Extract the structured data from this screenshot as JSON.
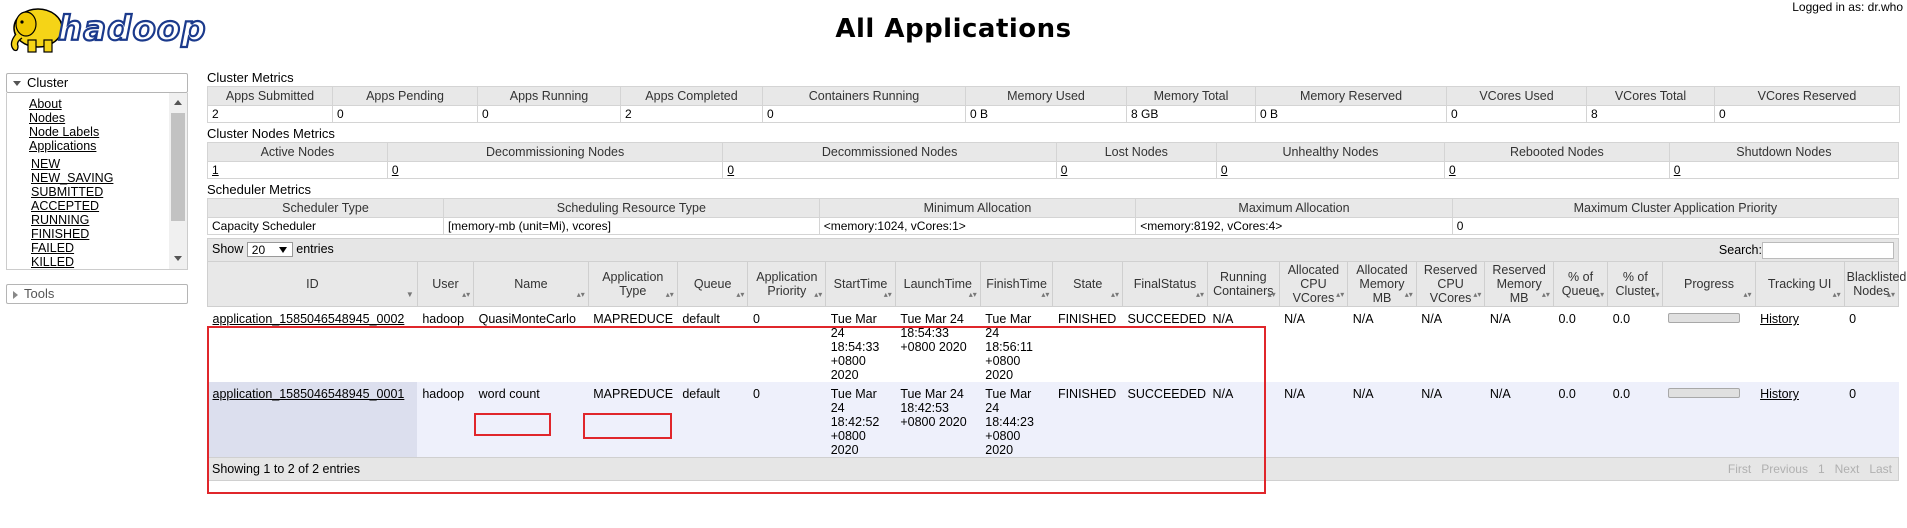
{
  "header": {
    "logo_text": "hadoop",
    "title": "All Applications",
    "login": "Logged in as: dr.who"
  },
  "nav": {
    "cluster_label": "Cluster",
    "items": [
      "About",
      "Nodes",
      "Node Labels",
      "Applications"
    ],
    "app_states": [
      "NEW",
      "NEW_SAVING",
      "SUBMITTED",
      "ACCEPTED",
      "RUNNING",
      "FINISHED",
      "FAILED",
      "KILLED"
    ],
    "tools_label": "Tools"
  },
  "cluster_metrics": {
    "title": "Cluster Metrics",
    "headers": [
      "Apps Submitted",
      "Apps Pending",
      "Apps Running",
      "Apps Completed",
      "Containers Running",
      "Memory Used",
      "Memory Total",
      "Memory Reserved",
      "VCores Used",
      "VCores Total",
      "VCores Reserved"
    ],
    "values": [
      "2",
      "0",
      "0",
      "2",
      "0",
      "0 B",
      "8 GB",
      "0 B",
      "0",
      "8",
      "0"
    ]
  },
  "cluster_nodes_metrics": {
    "title": "Cluster Nodes Metrics",
    "headers": [
      "Active Nodes",
      "Decommissioning Nodes",
      "Decommissioned Nodes",
      "Lost Nodes",
      "Unhealthy Nodes",
      "Rebooted Nodes",
      "Shutdown Nodes"
    ],
    "values": [
      "1",
      "0",
      "0",
      "0",
      "0",
      "0",
      "0"
    ]
  },
  "scheduler_metrics": {
    "title": "Scheduler Metrics",
    "headers": [
      "Scheduler Type",
      "Scheduling Resource Type",
      "Minimum Allocation",
      "Maximum Allocation",
      "Maximum Cluster Application Priority"
    ],
    "values": [
      "Capacity Scheduler",
      "[memory-mb (unit=Mi), vcores]",
      "<memory:1024, vCores:1>",
      "<memory:8192, vCores:4>",
      "0"
    ]
  },
  "apps": {
    "show_label": "Show",
    "page_size": "20",
    "entries_label": "entries",
    "search_label": "Search:",
    "columns": [
      {
        "l1": "ID",
        "l2": "",
        "l3": ""
      },
      {
        "l1": "User",
        "l2": "",
        "l3": ""
      },
      {
        "l1": "Name",
        "l2": "",
        "l3": ""
      },
      {
        "l1": "Application",
        "l2": "Type",
        "l3": ""
      },
      {
        "l1": "Queue",
        "l2": "",
        "l3": ""
      },
      {
        "l1": "Application",
        "l2": "Priority",
        "l3": ""
      },
      {
        "l1": "StartTime",
        "l2": "",
        "l3": ""
      },
      {
        "l1": "LaunchTime",
        "l2": "",
        "l3": ""
      },
      {
        "l1": "FinishTime",
        "l2": "",
        "l3": ""
      },
      {
        "l1": "State",
        "l2": "",
        "l3": ""
      },
      {
        "l1": "FinalStatus",
        "l2": "",
        "l3": ""
      },
      {
        "l1": "Running",
        "l2": "Containers",
        "l3": ""
      },
      {
        "l1": "Allocated",
        "l2": "CPU",
        "l3": "VCores"
      },
      {
        "l1": "Allocated",
        "l2": "Memory",
        "l3": "MB"
      },
      {
        "l1": "Reserved",
        "l2": "CPU",
        "l3": "VCores"
      },
      {
        "l1": "Reserved",
        "l2": "Memory",
        "l3": "MB"
      },
      {
        "l1": "% of",
        "l2": "Queue",
        "l3": ""
      },
      {
        "l1": "% of",
        "l2": "Cluster",
        "l3": ""
      },
      {
        "l1": "Progress",
        "l2": "",
        "l3": ""
      },
      {
        "l1": "Tracking UI",
        "l2": "",
        "l3": ""
      },
      {
        "l1": "Blacklisted",
        "l2": "Nodes",
        "l3": ""
      }
    ],
    "rows": [
      {
        "id": "application_1585046548945_0002",
        "user": "hadoop",
        "name": "QuasiMonteCarlo",
        "type": "MAPREDUCE",
        "queue": "default",
        "priority": "0",
        "start": [
          "Tue Mar",
          "24",
          "18:54:33",
          "+0800",
          "2020"
        ],
        "launch": [
          "Tue Mar 24",
          "18:54:33",
          "+0800 2020"
        ],
        "finish": [
          "Tue Mar",
          "24",
          "18:56:11",
          "+0800",
          "2020"
        ],
        "state": "FINISHED",
        "final_status": "SUCCEEDED",
        "running_containers": "N/A",
        "alloc_vcores": "N/A",
        "alloc_mem": "N/A",
        "res_vcores": "N/A",
        "res_mem": "N/A",
        "pct_queue": "0.0",
        "pct_cluster": "0.0",
        "progress": 0,
        "tracking_ui": "History",
        "blacklisted": "0"
      },
      {
        "id": "application_1585046548945_0001",
        "user": "hadoop",
        "name": "word count",
        "type": "MAPREDUCE",
        "queue": "default",
        "priority": "0",
        "start": [
          "Tue Mar",
          "24",
          "18:42:52",
          "+0800",
          "2020"
        ],
        "launch": [
          "Tue Mar 24",
          "18:42:53",
          "+0800 2020"
        ],
        "finish": [
          "Tue Mar",
          "24",
          "18:44:23",
          "+0800",
          "2020"
        ],
        "state": "FINISHED",
        "final_status": "SUCCEEDED",
        "running_containers": "N/A",
        "alloc_vcores": "N/A",
        "alloc_mem": "N/A",
        "res_vcores": "N/A",
        "res_mem": "N/A",
        "pct_queue": "0.0",
        "pct_cluster": "0.0",
        "progress": 0,
        "tracking_ui": "History",
        "blacklisted": "0"
      }
    ],
    "info": "Showing 1 to 2 of 2 entries",
    "pager": [
      "First",
      "Previous",
      "1",
      "Next",
      "Last"
    ]
  },
  "colors": {
    "highlight": "#e0262b",
    "header_bg": "#e8e8e8",
    "row_even": "#eef0fb"
  }
}
